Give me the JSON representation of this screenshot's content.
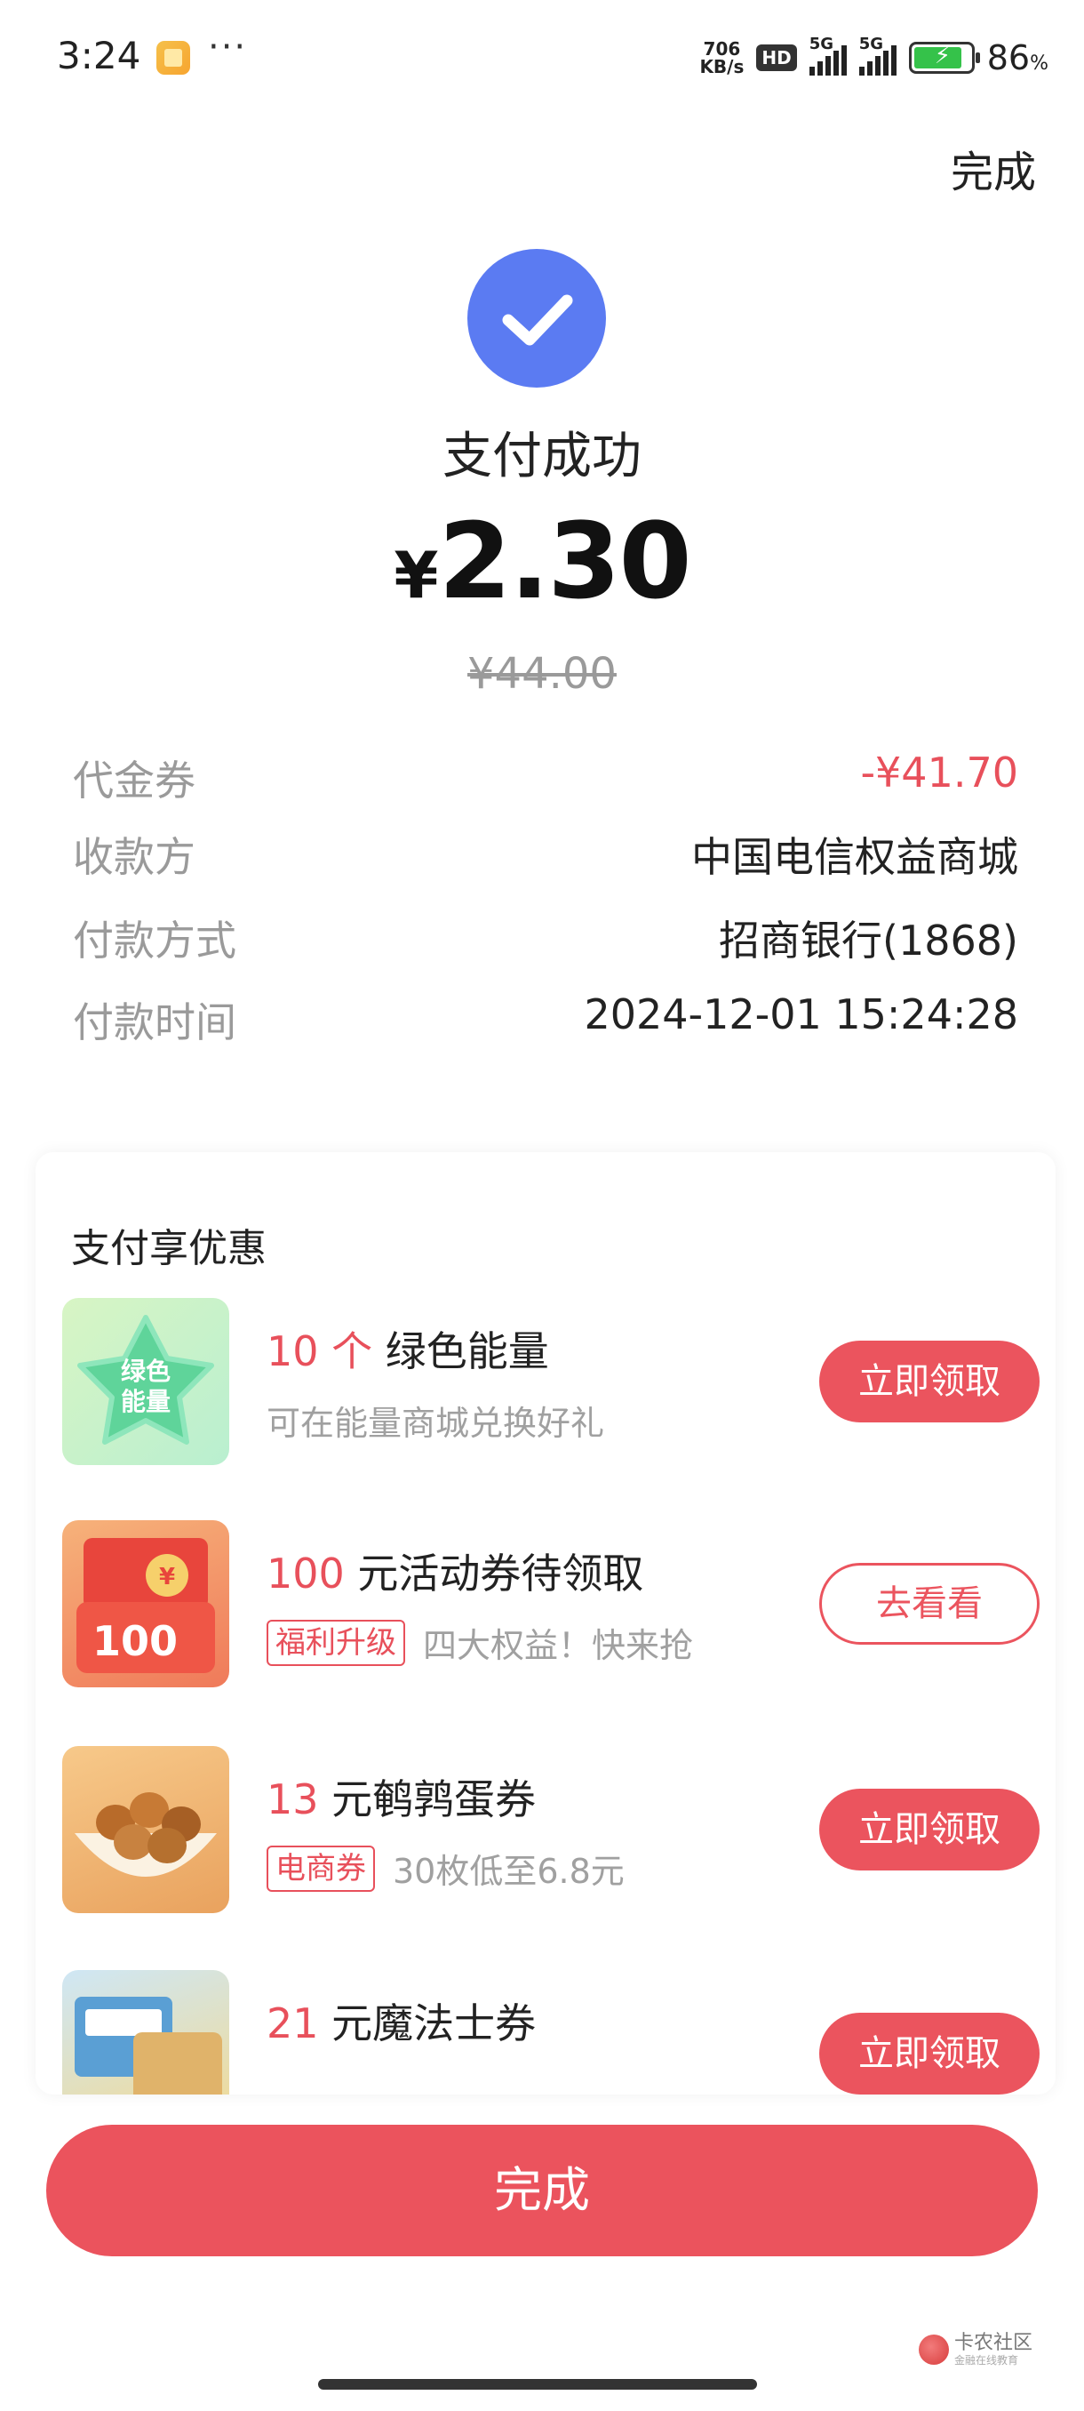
{
  "status_bar": {
    "time": "3:24",
    "more": "···",
    "net_speed_value": "706",
    "net_speed_unit": "KB/s",
    "hd": "HD",
    "sim1": "5G",
    "sim2": "5G",
    "battery_percent": "86",
    "battery_unit": "%",
    "battery_level": 0.86,
    "battery_color": "#35c24a"
  },
  "header": {
    "done_label": "完成"
  },
  "result": {
    "icon": "checkmark-icon",
    "icon_color": "#5b7bf2",
    "title": "支付成功",
    "currency": "¥",
    "amount": "2.30",
    "original_amount": "¥44.00"
  },
  "details": [
    {
      "label": "代金券",
      "value": "-¥41.70",
      "highlight": true
    },
    {
      "label": "收款方",
      "value": "中国电信权益商城",
      "highlight": false
    },
    {
      "label": "付款方式",
      "value": "招商银行(1868)",
      "highlight": false
    },
    {
      "label": "付款时间",
      "value": "2024-12-01 15:24:28",
      "highlight": false
    }
  ],
  "promo": {
    "title": "支付享优惠",
    "items": [
      {
        "highlight": "10 个",
        "title": " 绿色能量",
        "tag": "",
        "subtitle": "可在能量商城兑换好礼",
        "button": "立即领取",
        "button_style": "fill",
        "thumb_text": "绿色\n能量"
      },
      {
        "highlight": "100",
        "title": " 元活动券待领取",
        "tag": "福利升级",
        "subtitle": "四大权益！快来抢",
        "button": "去看看",
        "button_style": "outline",
        "thumb_text": "100"
      },
      {
        "highlight": "13",
        "title": " 元鹌鹑蛋券",
        "tag": "电商券",
        "subtitle": "30枚低至6.8元",
        "button": "立即领取",
        "button_style": "fill",
        "thumb_text": ""
      },
      {
        "highlight": "21",
        "title": " 元魔法士券",
        "tag": "",
        "subtitle": "",
        "button": "立即领取",
        "button_style": "fill",
        "thumb_text": ""
      }
    ]
  },
  "footer": {
    "done_label": "完成"
  },
  "watermark": {
    "text": "卡农社区",
    "subtext": "金融在线教育"
  },
  "colors": {
    "accent": "#eb545e",
    "primary_blue": "#5b7bf2",
    "muted": "#9a9a9a"
  }
}
